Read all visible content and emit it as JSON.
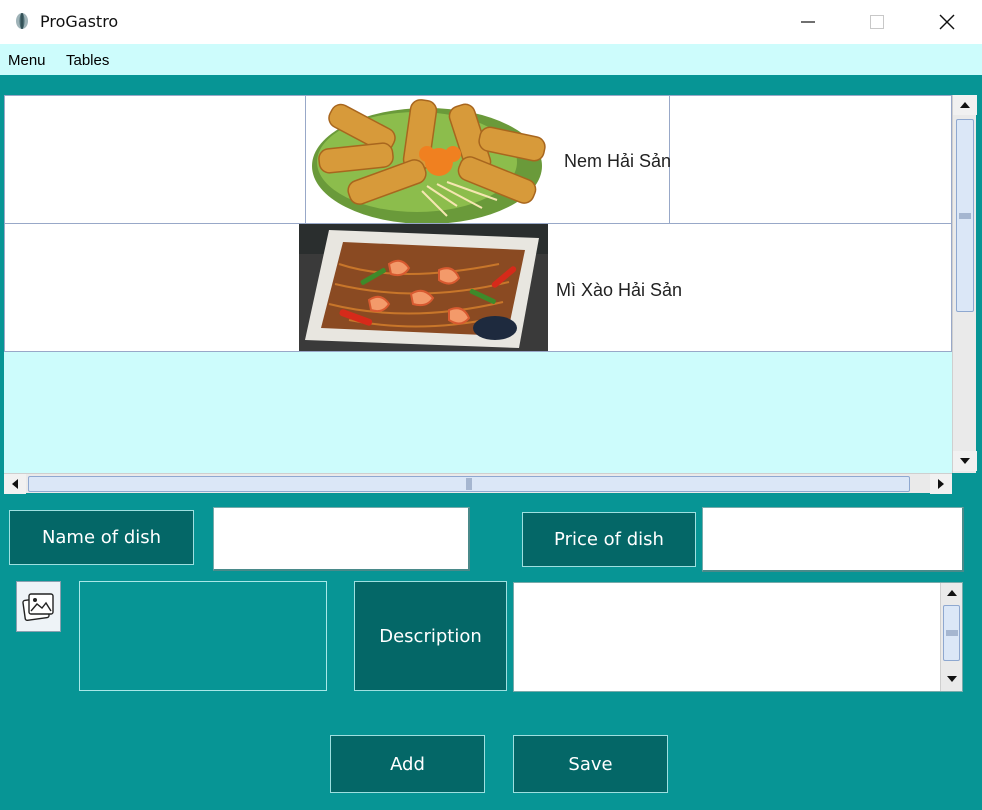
{
  "window": {
    "title": "ProGastro",
    "minimize_icon": "minimize-icon",
    "maximize_icon": "maximize-icon",
    "close_icon": "close-icon"
  },
  "menubar": {
    "items": [
      {
        "label": "Menu"
      },
      {
        "label": "Tables"
      }
    ]
  },
  "dishes": [
    {
      "name": "Nem Hải Sản",
      "image": "fried-spring-rolls-image"
    },
    {
      "name": "Mì Xào Hải Sản",
      "image": "seafood-stir-fried-noodles-image"
    }
  ],
  "form": {
    "name_label": "Name of dish",
    "name_value": "",
    "price_label": "Price of dish",
    "price_value": "",
    "image_button_icon": "image-gallery-icon",
    "description_label": "Description",
    "description_value": "",
    "add_label": "Add",
    "save_label": "Save"
  },
  "colors": {
    "background": "#079595",
    "menubar": "#cdfcfc",
    "button": "#046767"
  }
}
